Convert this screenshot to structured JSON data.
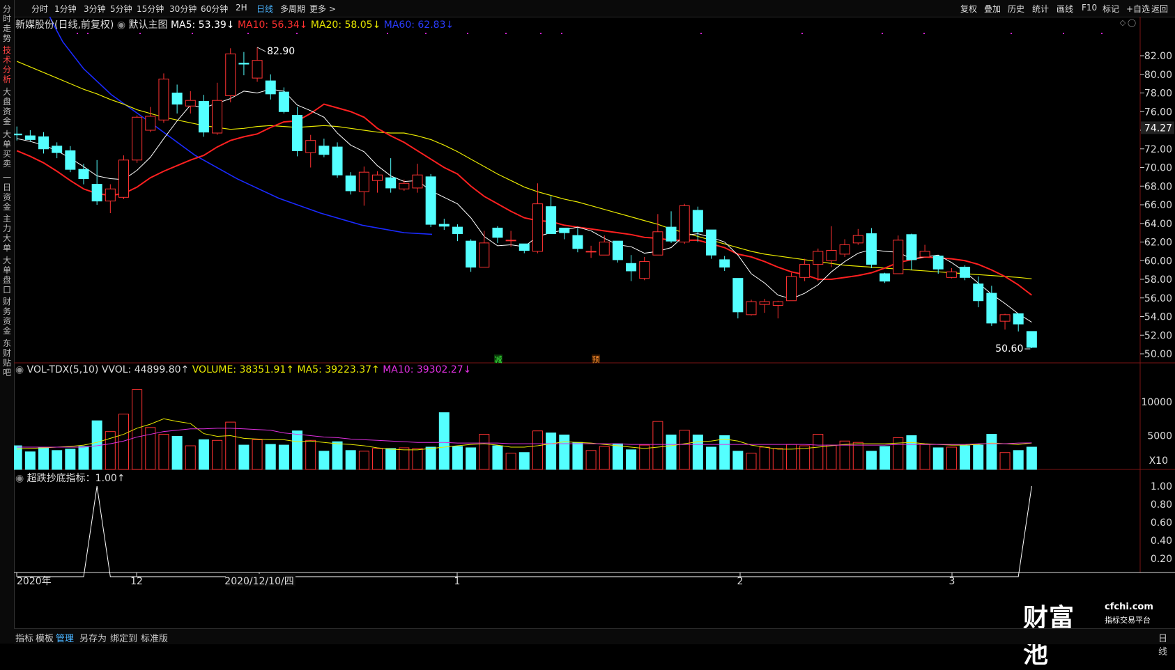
{
  "toolbar": {
    "periods": [
      "分时",
      "1分钟",
      "3分钟",
      "5分钟",
      "15分钟",
      "30分钟",
      "60分钟",
      "2H",
      "日线",
      "多周期",
      "更多 >"
    ],
    "active_period": "日线",
    "right": [
      "复权",
      "叠加",
      "历史",
      "统计",
      "画线",
      "F10",
      "标记",
      "+自选",
      "返回"
    ]
  },
  "sidebar": [
    "分时走势",
    "技术分析",
    "大盘资金",
    "大单买卖",
    "一日资金",
    "主力大单",
    "大单盘口",
    "财务资金",
    "东财贴吧"
  ],
  "sidebar_active": "技术分析",
  "main_legend": {
    "stock": "新媒股份(日线,前复权)",
    "template": "默认主图",
    "ma5": "MA5: 53.39↓",
    "ma10": "MA10: 56.34↓",
    "ma20": "MA20: 58.05↓",
    "ma60": "MA60: 62.83↓"
  },
  "price_axis": [
    "82.00",
    "80.00",
    "78.00",
    "76.00",
    "74.00",
    "72.00",
    "70.00",
    "68.00",
    "66.00",
    "64.00",
    "62.00",
    "60.00",
    "58.00",
    "56.00",
    "54.00",
    "52.00",
    "50.00"
  ],
  "current_price": "74.27",
  "high_label": "82.90",
  "low_label": "50.60",
  "markers": {
    "jian": "减",
    "yu": "预"
  },
  "vol_legend": {
    "name": "VOL-TDX(5,10)",
    "vvol": "VVOL: 44899.80↑",
    "volume": "VOLUME: 38351.91↑",
    "ma5": "MA5: 39223.37↑",
    "ma10": "MA10: 39302.27↓"
  },
  "vol_axis": [
    "10000",
    "5000"
  ],
  "vol_unit": "X10",
  "ind_legend": "超跌抄底指标：1.00↑",
  "ind_axis": [
    "1.00",
    "0.80",
    "0.60",
    "0.40",
    "0.20"
  ],
  "time_axis": {
    "year": "2020年",
    "m12": "12",
    "date": "2020/12/10/四",
    "m1": "1",
    "m2": "2",
    "m3": "3"
  },
  "watermark": {
    "brand": "财富池",
    "domain": "cfchi.com",
    "slogan": "指标交易平台"
  },
  "bottom_tabs": [
    "指标",
    "模板",
    "管理",
    "另存为",
    "绑定到",
    "标准版"
  ],
  "bottom_active": "管理",
  "bottom_right": "日线",
  "colors": {
    "up": "#ff3232",
    "down": "#54ffff",
    "ma5": "#ffffff",
    "ma10": "#ff2020",
    "ma20": "#e8e800",
    "ma60": "#1a2aff",
    "vma5": "#e8e800",
    "vma10": "#e030e0"
  },
  "candles": [
    [
      73.6,
      73.5,
      74.4,
      72.9
    ],
    [
      73.4,
      73.0,
      74.0,
      72.8
    ],
    [
      73.3,
      72.0,
      73.8,
      71.5
    ],
    [
      72.3,
      71.6,
      72.7,
      71.0
    ],
    [
      71.8,
      69.8,
      72.3,
      69.5
    ],
    [
      69.8,
      68.8,
      70.4,
      68.2
    ],
    [
      68.2,
      66.4,
      70.8,
      66.0
    ],
    [
      66.4,
      67.7,
      68.2,
      65.1
    ],
    [
      66.8,
      70.8,
      71.3,
      66.6
    ],
    [
      70.8,
      75.4,
      75.6,
      70.5
    ],
    [
      74.0,
      75.5,
      76.5,
      73.8
    ],
    [
      75.1,
      79.5,
      80.1,
      74.8
    ],
    [
      78.0,
      76.8,
      78.9,
      75.8
    ],
    [
      76.6,
      77.2,
      78.2,
      75.8
    ],
    [
      77.1,
      73.8,
      77.8,
      73.3
    ],
    [
      73.7,
      77.2,
      79.1,
      73.5
    ],
    [
      77.7,
      82.2,
      82.8,
      77.0
    ],
    [
      81.2,
      81.1,
      82.4,
      79.9
    ],
    [
      79.6,
      81.5,
      82.9,
      79.2
    ],
    [
      79.3,
      77.9,
      80.0,
      77.3
    ],
    [
      78.1,
      76.0,
      78.6,
      75.8
    ],
    [
      75.6,
      71.8,
      76.5,
      71.2
    ],
    [
      71.6,
      72.9,
      73.5,
      70.0
    ],
    [
      72.3,
      71.4,
      73.1,
      71.1
    ],
    [
      72.2,
      69.2,
      72.7,
      68.9
    ],
    [
      69.1,
      67.5,
      69.5,
      67.1
    ],
    [
      67.4,
      69.5,
      70.1,
      65.9
    ],
    [
      68.6,
      69.2,
      69.6,
      67.3
    ],
    [
      68.9,
      67.8,
      71.0,
      67.3
    ],
    [
      67.7,
      68.3,
      68.7,
      67.5
    ],
    [
      67.8,
      69.2,
      70.4,
      67.3
    ],
    [
      69.0,
      63.9,
      69.3,
      63.6
    ],
    [
      63.9,
      63.7,
      64.5,
      63.3
    ],
    [
      63.6,
      62.9,
      63.9,
      62.1
    ],
    [
      62.1,
      59.3,
      62.3,
      58.8
    ],
    [
      59.3,
      61.9,
      63.2,
      59.3
    ],
    [
      63.5,
      62.5,
      63.7,
      61.9
    ],
    [
      62.2,
      62.2,
      63.2,
      61.5
    ],
    [
      61.8,
      61.1,
      61.8,
      60.8
    ],
    [
      61.0,
      66.1,
      68.3,
      60.8
    ],
    [
      65.8,
      62.9,
      66.9,
      62.9
    ],
    [
      63.5,
      63.0,
      63.5,
      62.3
    ],
    [
      62.7,
      61.3,
      63.5,
      60.9
    ],
    [
      61.0,
      61.0,
      61.6,
      60.3
    ],
    [
      60.6,
      62.0,
      62.7,
      60.6
    ],
    [
      62.1,
      60.1,
      62.1,
      59.8
    ],
    [
      59.7,
      58.9,
      60.6,
      57.8
    ],
    [
      58.1,
      59.9,
      60.4,
      57.9
    ],
    [
      60.6,
      63.1,
      65.0,
      60.6
    ],
    [
      63.6,
      62.1,
      65.3,
      61.9
    ],
    [
      62.0,
      65.9,
      66.1,
      61.8
    ],
    [
      65.4,
      63.1,
      65.8,
      62.0
    ],
    [
      63.3,
      60.6,
      63.3,
      60.2
    ],
    [
      60.1,
      59.3,
      60.5,
      58.9
    ],
    [
      58.1,
      54.5,
      58.1,
      53.8
    ],
    [
      54.2,
      55.6,
      55.8,
      54.1
    ],
    [
      55.3,
      55.6,
      55.9,
      54.4
    ],
    [
      55.2,
      55.6,
      55.7,
      53.8
    ],
    [
      55.7,
      58.3,
      58.7,
      55.7
    ],
    [
      58.2,
      59.6,
      60.2,
      57.8
    ],
    [
      59.6,
      61.0,
      61.3,
      57.8
    ],
    [
      60.0,
      61.1,
      63.7,
      59.3
    ],
    [
      60.7,
      61.7,
      62.3,
      60.4
    ],
    [
      61.9,
      62.7,
      63.4,
      61.7
    ],
    [
      62.9,
      59.6,
      63.5,
      59.2
    ],
    [
      58.6,
      57.8,
      58.7,
      57.6
    ],
    [
      58.6,
      62.2,
      62.7,
      58.6
    ],
    [
      62.8,
      60.1,
      62.9,
      59.0
    ],
    [
      60.4,
      61.0,
      61.7,
      60.4
    ],
    [
      60.5,
      59.1,
      60.5,
      58.6
    ],
    [
      58.2,
      58.8,
      59.2,
      58.1
    ],
    [
      59.3,
      58.2,
      59.5,
      57.9
    ],
    [
      57.5,
      55.7,
      58.3,
      55.0
    ],
    [
      56.5,
      53.3,
      57.3,
      53.0
    ],
    [
      53.5,
      54.2,
      54.3,
      52.6
    ],
    [
      54.3,
      53.2,
      54.3,
      52.4
    ],
    [
      52.4,
      50.7,
      52.4,
      50.6
    ]
  ],
  "ma5": [
    73.1,
    72.8,
    72.4,
    71.8,
    71.0,
    70.1,
    69.1,
    68.8,
    68.7,
    69.7,
    71.1,
    73.1,
    75.0,
    76.7,
    76.4,
    76.9,
    77.4,
    78.2,
    78.0,
    78.4,
    78.2,
    76.7,
    76.1,
    75.4,
    73.7,
    72.4,
    71.7,
    70.2,
    69.1,
    68.5,
    68.6,
    67.5,
    66.8,
    66.1,
    64.6,
    62.6,
    61.6,
    61.7,
    61.5,
    62.6,
    63.0,
    63.3,
    63.6,
    63.2,
    62.4,
    61.7,
    61.5,
    60.8,
    61.0,
    61.4,
    62.7,
    62.9,
    62.5,
    62.0,
    60.6,
    58.6,
    57.6,
    56.3,
    55.9,
    56.5,
    57.4,
    58.8,
    59.9,
    60.8,
    61.2,
    61.0,
    60.9,
    60.2,
    60.4,
    60.6,
    59.8,
    58.8,
    57.6,
    56.4,
    55.4,
    54.3,
    53.4
  ],
  "ma10": [
    71.8,
    71.2,
    70.5,
    69.6,
    68.6,
    67.7,
    67.2,
    67.0,
    67.2,
    67.9,
    68.9,
    69.6,
    70.2,
    70.8,
    71.3,
    72.2,
    72.9,
    73.3,
    73.6,
    74.3,
    74.9,
    75.0,
    75.8,
    76.8,
    76.4,
    76.0,
    75.4,
    74.2,
    73.4,
    72.7,
    71.8,
    70.9,
    70.0,
    69.3,
    68.0,
    66.9,
    66.1,
    65.3,
    64.6,
    64.3,
    64.2,
    63.8,
    63.6,
    63.4,
    63.2,
    63.0,
    62.8,
    62.5,
    62.4,
    62.2,
    62.2,
    62.2,
    61.8,
    61.4,
    60.7,
    60.4,
    59.9,
    59.3,
    58.8,
    58.5,
    58.0,
    58.0,
    58.2,
    58.4,
    58.7,
    59.2,
    59.8,
    60.1,
    60.4,
    60.3,
    60.2,
    60.0,
    59.6,
    59.0,
    58.3,
    57.4,
    56.3
  ],
  "ma20": [
    81.4,
    80.8,
    80.2,
    79.6,
    79.0,
    78.4,
    77.9,
    77.3,
    76.8,
    76.2,
    75.8,
    75.4,
    75.1,
    74.8,
    74.5,
    74.3,
    74.1,
    74.2,
    74.4,
    74.5,
    74.4,
    74.3,
    74.4,
    74.5,
    74.4,
    74.2,
    74.0,
    73.8,
    73.7,
    73.7,
    73.4,
    73.0,
    72.4,
    71.7,
    70.9,
    70.1,
    69.3,
    68.6,
    67.9,
    67.4,
    67.0,
    66.6,
    66.3,
    65.9,
    65.5,
    65.1,
    64.7,
    64.3,
    63.9,
    63.4,
    63.0,
    62.6,
    62.2,
    61.8,
    61.4,
    61.0,
    60.7,
    60.5,
    60.3,
    60.1,
    59.9,
    59.7,
    59.5,
    59.4,
    59.3,
    59.2,
    59.1,
    59.0,
    58.9,
    58.8,
    58.7,
    58.6,
    58.5,
    58.4,
    58.3,
    58.2,
    58.05
  ],
  "ma60_pts": [
    [
      23,
      91.0
    ],
    [
      40,
      88.0
    ],
    [
      55,
      85.6
    ],
    [
      70,
      83.5
    ],
    [
      100,
      80.6
    ],
    [
      140,
      77.8
    ],
    [
      200,
      74.6
    ],
    [
      260,
      71.3
    ],
    [
      320,
      68.8
    ],
    [
      380,
      66.7
    ],
    [
      440,
      65.1
    ],
    [
      500,
      63.8
    ],
    [
      530,
      63.4
    ],
    [
      560,
      63.0
    ],
    [
      600,
      62.83
    ]
  ],
  "volume": [
    35,
    26,
    32,
    28,
    30,
    34,
    72,
    56,
    82,
    118,
    62,
    52,
    49,
    35,
    44,
    43,
    70,
    36,
    44,
    37,
    36,
    57,
    43,
    27,
    41,
    28,
    27,
    31,
    31,
    32,
    31,
    33,
    84,
    34,
    32,
    52,
    35,
    24,
    25,
    57,
    54,
    51,
    40,
    28,
    34,
    38,
    29,
    36,
    71,
    51,
    58,
    51,
    33,
    50,
    27,
    24,
    33,
    31,
    37,
    35,
    52,
    36,
    42,
    40,
    27,
    34,
    47,
    50,
    37,
    32,
    33,
    35,
    36,
    52,
    25,
    28,
    33
  ],
  "vma5": [
    30,
    31,
    32,
    33,
    34,
    36,
    40,
    46,
    52,
    61,
    67,
    75,
    71,
    68,
    53,
    49,
    50,
    46,
    45,
    44,
    44,
    41,
    42,
    40,
    38,
    37,
    35,
    32,
    30,
    29,
    29,
    31,
    33,
    35,
    37,
    38,
    36,
    33,
    33,
    35,
    38,
    41,
    40,
    39,
    37,
    35,
    33,
    31,
    33,
    35,
    38,
    41,
    42,
    45,
    42,
    36,
    33,
    30,
    30,
    31,
    33,
    35,
    37,
    38,
    38,
    38,
    39,
    40,
    38,
    37,
    36,
    36,
    37,
    39,
    38,
    37,
    39
  ],
  "vma10": [
    33,
    33,
    33,
    33,
    33,
    33,
    35,
    38,
    42,
    48,
    52,
    56,
    58,
    60,
    60,
    61,
    61,
    60,
    59,
    58,
    54,
    52,
    50,
    48,
    47,
    45,
    44,
    43,
    42,
    41,
    40,
    40,
    40,
    39,
    39,
    39,
    39,
    38,
    38,
    38,
    38,
    38,
    38,
    38,
    38,
    38,
    37,
    37,
    37,
    37,
    37,
    37,
    37,
    37,
    37,
    37,
    37,
    37,
    37,
    37,
    36,
    36,
    36,
    36,
    36,
    36,
    37,
    37,
    37,
    37,
    37,
    37,
    38,
    38,
    38,
    39,
    39.3
  ]
}
